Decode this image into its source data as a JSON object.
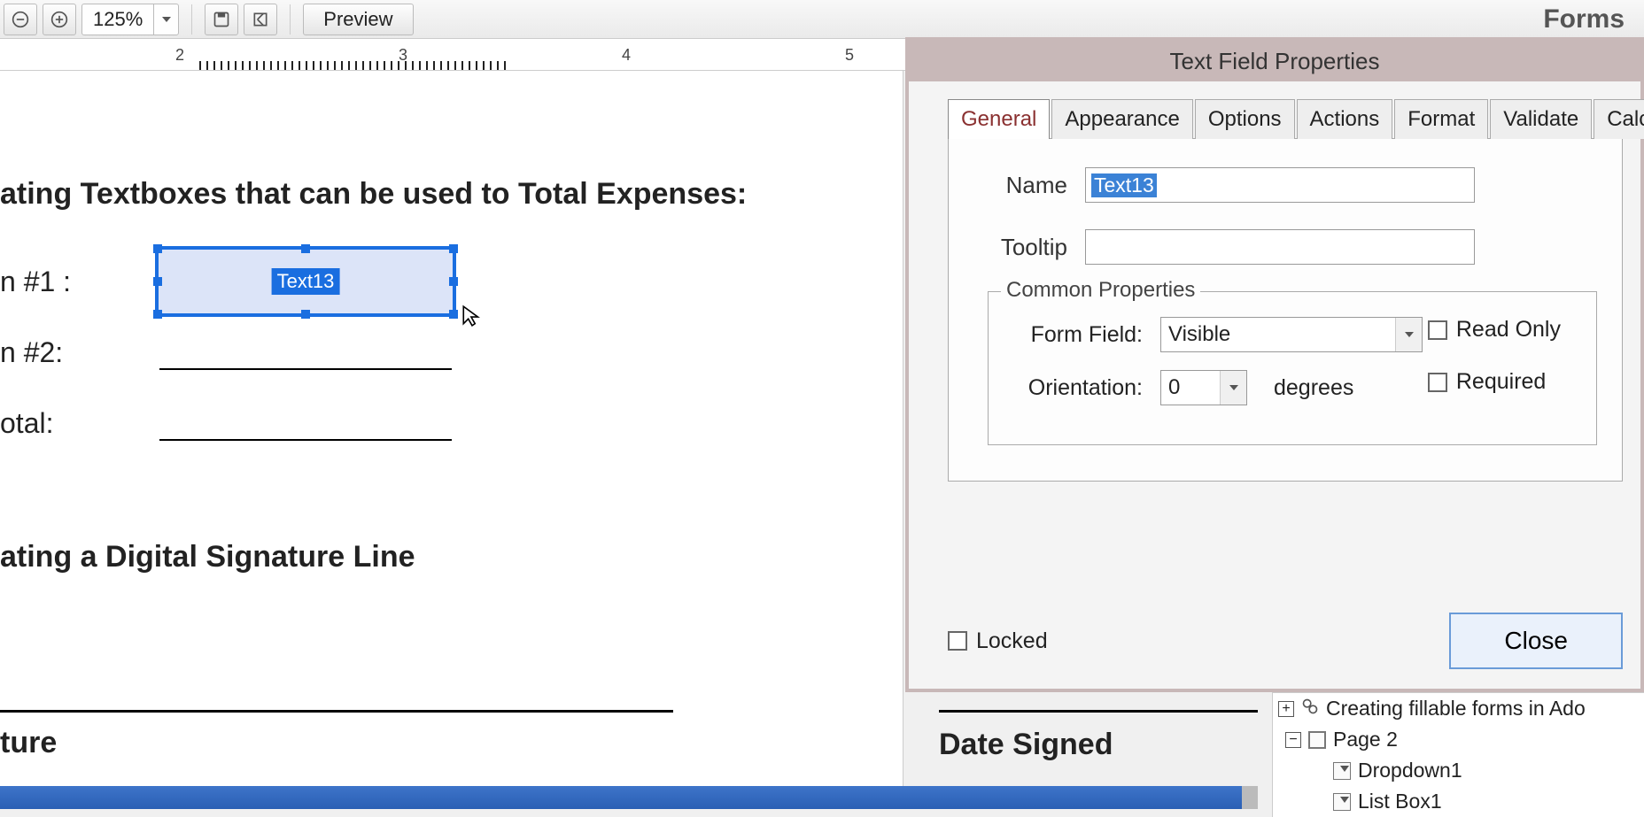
{
  "toolbar": {
    "zoom_value": "125%",
    "preview_label": "Preview",
    "forms_label": "Forms"
  },
  "ruler": {
    "ticks": [
      "2",
      "3",
      "4",
      "5"
    ]
  },
  "doc": {
    "heading1_partial": "ating Textboxes that can be used to Total Expenses:",
    "row1_label_partial": "n #1 :",
    "row2_label_partial": "n #2:",
    "total_label_partial": "otal:",
    "heading2_partial": "ating a Digital Signature Line",
    "signature_label_partial": "ture",
    "date_signed_label": "Date Signed",
    "selected_field_label": "Text13"
  },
  "dialog": {
    "title": "Text Field Properties",
    "tabs": {
      "general": "General",
      "appearance": "Appearance",
      "options": "Options",
      "actions": "Actions",
      "format": "Format",
      "validate": "Validate",
      "calculate": "Calculate"
    },
    "name_label": "Name",
    "name_value": "Text13",
    "tooltip_label": "Tooltip",
    "tooltip_value": "",
    "common_properties_legend": "Common Properties",
    "form_field_label": "Form Field:",
    "form_field_value": "Visible",
    "orientation_label": "Orientation:",
    "orientation_value": "0",
    "orientation_units": "degrees",
    "read_only_label": "Read Only",
    "required_label": "Required",
    "locked_label": "Locked",
    "close_label": "Close"
  },
  "tree": {
    "root": "Creating fillable forms in Ado",
    "page": "Page 2",
    "item1": "Dropdown1",
    "item2": "List Box1"
  }
}
